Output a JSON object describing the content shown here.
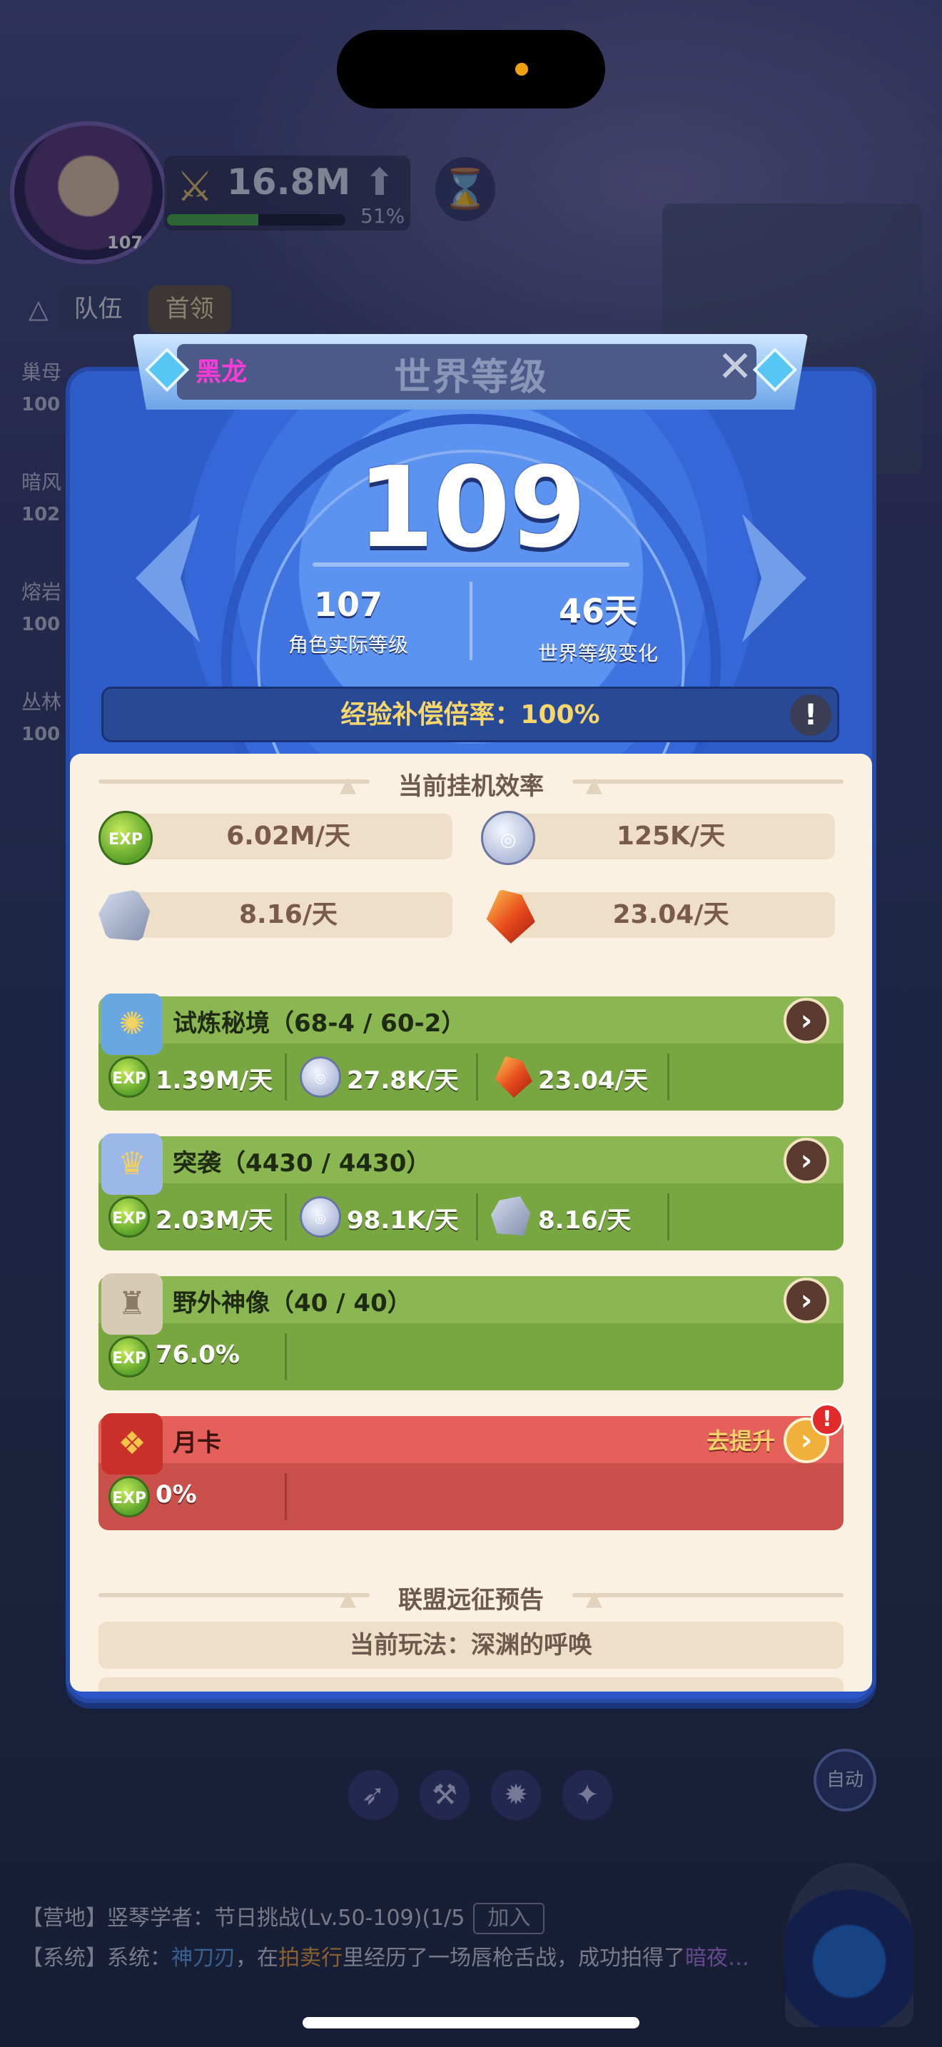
{
  "hud": {
    "avatar_level": "107",
    "power": "16.8M",
    "power_progress": 0.51,
    "power_percent": "51%",
    "tabs": [
      "队伍",
      "首领"
    ],
    "side_list": [
      {
        "name": "巢母",
        "level": "100"
      },
      {
        "name": "暗风",
        "level": "102"
      },
      {
        "name": "熔岩",
        "level": "100"
      },
      {
        "name": "丛林",
        "level": "100"
      }
    ],
    "auto_label": "自动"
  },
  "modal": {
    "user_name": "黑龙",
    "title": "世界等级",
    "world_level": "109",
    "stats": [
      {
        "value": "107",
        "label": "角色实际等级"
      },
      {
        "value": "46天",
        "label": "世界等级变化"
      }
    ],
    "exp_rate_label": "经验补偿倍率：",
    "exp_rate_value": "100%",
    "efficiency_title": "当前挂机效率",
    "efficiency": [
      {
        "icon": "exp-icon",
        "value": "6.02M/天"
      },
      {
        "icon": "coin-icon",
        "value": "125K/天"
      },
      {
        "icon": "ore-icon",
        "value": "8.16/天"
      },
      {
        "icon": "red-gem-icon",
        "value": "23.04/天"
      }
    ],
    "cards": [
      {
        "title": "试炼秘境（68-4 / 60-2）",
        "icon": "trial-realm-icon",
        "color": "green",
        "cells": [
          {
            "icon": "exp-icon",
            "value": "1.39M/天"
          },
          {
            "icon": "coin-icon",
            "value": "27.8K/天"
          },
          {
            "icon": "red-gem-icon",
            "value": "23.04/天"
          }
        ]
      },
      {
        "title": "突袭（4430 / 4430）",
        "icon": "raid-icon",
        "color": "green",
        "cells": [
          {
            "icon": "exp-icon",
            "value": "2.03M/天"
          },
          {
            "icon": "coin-icon",
            "value": "98.1K/天"
          },
          {
            "icon": "ore-icon",
            "value": "8.16/天"
          }
        ]
      },
      {
        "title": "野外神像（40 / 40）",
        "icon": "statue-icon",
        "color": "green",
        "cells": [
          {
            "icon": "exp-icon",
            "value": "76.0%"
          }
        ]
      },
      {
        "title": "月卡",
        "icon": "monthly-card-icon",
        "color": "red",
        "upgrade_label": "去提升",
        "cells": [
          {
            "icon": "exp-icon",
            "value": "0%"
          }
        ]
      }
    ],
    "union_title": "联盟远征预告",
    "union_current": "当前玩法：深渊的呼唤"
  },
  "chat": [
    {
      "channel": "【营地】",
      "text": "竖琴学者：节日挑战(Lv.50-109)(1/5",
      "button": "加入"
    },
    {
      "channel": "【系统】",
      "prefix": "系统：",
      "player": "神刀刃",
      "mid1": "，在",
      "shop": "拍卖行",
      "mid2": "里经历了一场唇枪舌战，成功拍得了",
      "item": "暗夜…"
    }
  ],
  "colors": {
    "modal_blue": "#2d56c8",
    "cream": "#fbf1e3",
    "green_card": "#8bb752",
    "red_card": "#e5605a",
    "user_name": "#ff3ad6",
    "exp_rate": "#f7d66a"
  }
}
